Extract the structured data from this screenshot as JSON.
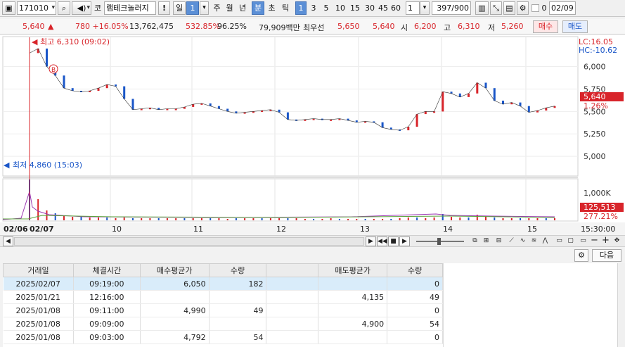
{
  "toolbar": {
    "code": "171010",
    "market": "코",
    "stock_name": "램테크놀러지",
    "alert_label": "!",
    "period_day": "일",
    "period_value": "1",
    "period_week": "주",
    "period_month": "월",
    "period_year": "년",
    "period_min": "분",
    "period_sec": "초",
    "period_tick": "틱",
    "intervals": [
      "1",
      "3",
      "5",
      "10",
      "15",
      "30",
      "45",
      "60"
    ],
    "unit_value": "1",
    "count": "397",
    "count_max": "/900",
    "date_checkbox_label": "0",
    "date": "02/09"
  },
  "quote": {
    "price": "5,640",
    "change": "780 +16.05%",
    "volume": "13,762,475",
    "volume_ratio": "532.85%",
    "strength": "96.25%",
    "amount": "79,909백만",
    "best_ask_label": "최우선",
    "best_ask": "5,650",
    "best_bid": "5,640",
    "open_label": "시",
    "open": "6,200",
    "high_label": "고",
    "high": "6,310",
    "low_label": "저",
    "low": "5,260",
    "buy_label": "매수",
    "sell_label": "매도"
  },
  "chart": {
    "high_marker": "최고 6,310 (09:02)",
    "low_marker": "최저 4,860 (15:03)",
    "lc_label": "LC:16.05",
    "hc_label": "HC:-10.62",
    "price_tag": "5,640",
    "pct_tag": "1.26%",
    "vol_tag": "125,513",
    "vol_pct_tag": "277.21%",
    "b_marker": "B",
    "date_start": "02/06",
    "date_start2": "02/07",
    "time_end": "15:30:00"
  },
  "chart_data": {
    "type": "line",
    "series": [
      {
        "values": [
          6150,
          6200,
          6000,
          5900,
          5760,
          5730,
          5720,
          5730,
          5760,
          5800,
          5780,
          5640,
          5520,
          5530,
          5540,
          5520,
          5530,
          5530,
          5550,
          5580,
          5590,
          5560,
          5530,
          5500,
          5480,
          5490,
          5500,
          5510,
          5520,
          5490,
          5410,
          5400,
          5410,
          5420,
          5410,
          5410,
          5420,
          5400,
          5380,
          5390,
          5380,
          5320,
          5300,
          5290,
          5330,
          5470,
          5500,
          5500,
          5720,
          5700,
          5660,
          5700,
          5820,
          5760,
          5620,
          5580,
          5600,
          5560,
          5490,
          5510,
          5540,
          5560
        ]
      }
    ],
    "ylim": [
      4860,
      6310
    ],
    "y_ticks": [
      "6,000",
      "5,750",
      "5,500",
      "5,250",
      "5,000"
    ],
    "x_labels": [
      "10",
      "11",
      "12",
      "13",
      "14",
      "15"
    ],
    "volume_ticks": [
      "1,000K"
    ]
  },
  "panel": {
    "next_label": "다음"
  },
  "table": {
    "headers": [
      "거래일",
      "체결시간",
      "매수평균가",
      "수량",
      "",
      "매도평균가",
      "수량"
    ],
    "rows": [
      [
        "2025/02/07",
        "09:19:00",
        "6,050",
        "182",
        "",
        "",
        "0"
      ],
      [
        "2025/01/21",
        "12:16:00",
        "",
        "",
        "",
        "4,135",
        "49"
      ],
      [
        "2025/01/08",
        "09:11:00",
        "4,990",
        "49",
        "",
        "",
        "0"
      ],
      [
        "2025/01/08",
        "09:09:00",
        "",
        "",
        "",
        "4,900",
        "54"
      ],
      [
        "2025/01/08",
        "09:03:00",
        "4,792",
        "54",
        "",
        "",
        "0"
      ]
    ]
  },
  "colors": {
    "up": "#d8242a",
    "down": "#1a56c8",
    "selected": "#5b8fd6",
    "price_tag_bg": "#d8242a"
  }
}
